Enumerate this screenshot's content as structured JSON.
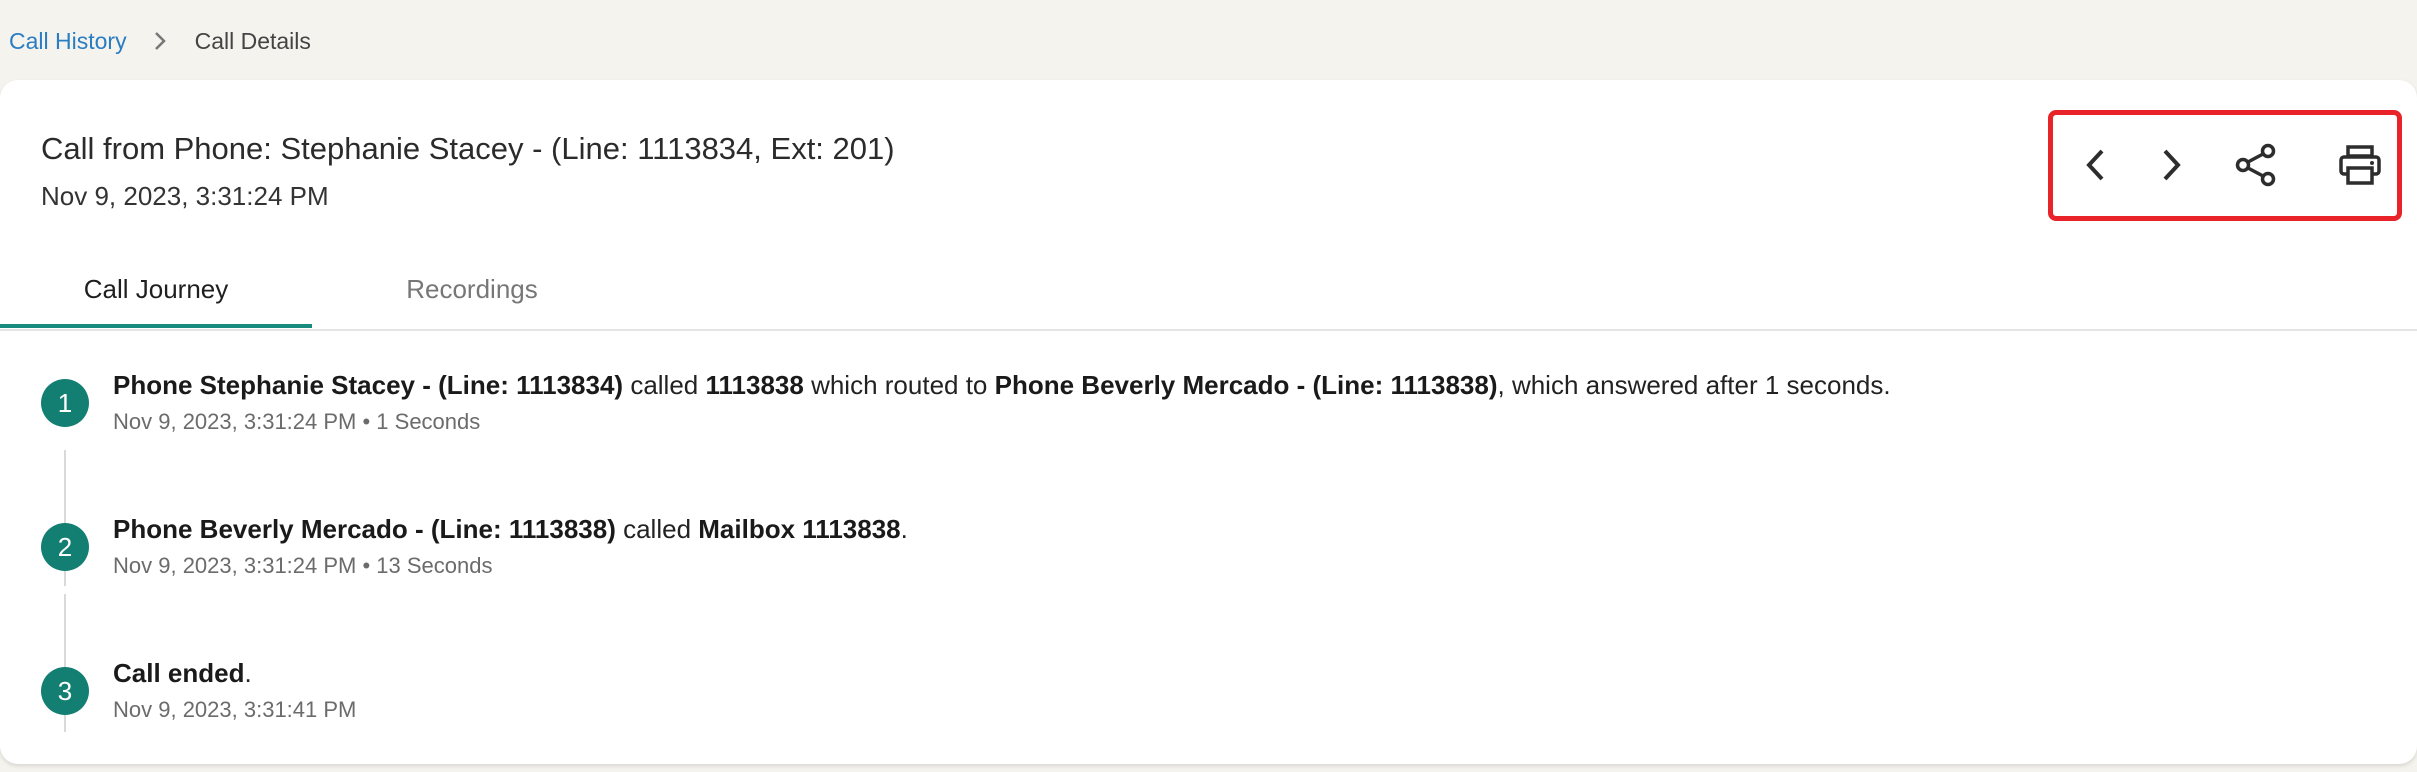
{
  "breadcrumb": {
    "parent": "Call History",
    "current": "Call Details"
  },
  "header": {
    "title": "Call from Phone:  Stephanie Stacey - (Line: 1113834, Ext: 201)",
    "datetime": "Nov 9, 2023, 3:31:24 PM"
  },
  "actions": {
    "icons": [
      "chevron-left-icon",
      "chevron-right-icon",
      "share-icon",
      "print-icon"
    ],
    "highlight_color": "#e8242a"
  },
  "tabs": [
    {
      "label": "Call Journey",
      "active": true
    },
    {
      "label": "Recordings",
      "active": false
    }
  ],
  "steps": [
    {
      "number": "1",
      "parts": [
        {
          "text": "Phone Stephanie Stacey - (Line: 1113834)",
          "bold": true
        },
        {
          "text": " called ",
          "bold": false
        },
        {
          "text": "1113838",
          "bold": true
        },
        {
          "text": " which routed to ",
          "bold": false
        },
        {
          "text": "Phone Beverly Mercado - (Line: 1113838)",
          "bold": true
        },
        {
          "text": ", which answered after 1 seconds.",
          "bold": false
        }
      ],
      "meta": "Nov 9, 2023, 3:31:24 PM • 1  Seconds"
    },
    {
      "number": "2",
      "parts": [
        {
          "text": "Phone Beverly Mercado - (Line: 1113838)",
          "bold": true
        },
        {
          "text": " called ",
          "bold": false
        },
        {
          "text": "Mailbox 1113838",
          "bold": true
        },
        {
          "text": ".",
          "bold": false
        }
      ],
      "meta": "Nov 9, 2023, 3:31:24 PM • 13 Seconds"
    },
    {
      "number": "3",
      "parts": [
        {
          "text": "Call ended",
          "bold": true
        },
        {
          "text": ".",
          "bold": false
        }
      ],
      "meta": "Nov 9, 2023, 3:31:41 PM"
    }
  ],
  "colors": {
    "accent": "#137f72",
    "link": "#2a7dc1",
    "background": "#f5f3ee"
  }
}
